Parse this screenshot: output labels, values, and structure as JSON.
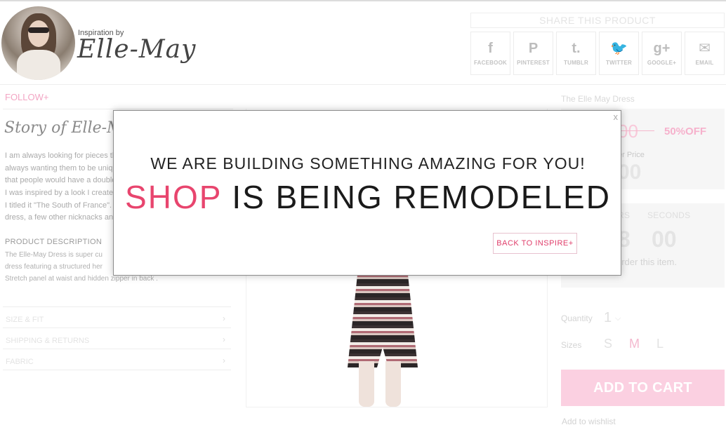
{
  "header": {
    "inspiration_label": "Inspiration by",
    "name_script": "Elle-May"
  },
  "share": {
    "title": "SHARE THIS PRODUCT",
    "buttons": [
      {
        "glyph": "f",
        "label": "FACEBOOK",
        "icon": "facebook-icon"
      },
      {
        "glyph": "P",
        "label": "PINTEREST",
        "icon": "pinterest-icon"
      },
      {
        "glyph": "t.",
        "label": "TUMBLR",
        "icon": "tumblr-icon"
      },
      {
        "glyph": "🐦",
        "label": "TWITTER",
        "icon": "twitter-icon"
      },
      {
        "glyph": "g+",
        "label": "GOOGLE+",
        "icon": "google-plus-icon"
      },
      {
        "glyph": "✉",
        "label": "EMAIL",
        "icon": "email-icon"
      }
    ]
  },
  "left": {
    "follow": "FOLLOW+",
    "story_title": "Story of Elle-Ma",
    "story_lines": [
      "I am always looking for pieces th",
      "always wanting them to be uniq",
      "that people would have a double",
      "I was inspired by a look I create",
      "I titled it \"The South of France\".",
      "dress, a few other nicknacks an"
    ],
    "description_title": "PRODUCT  DESCRIPTION",
    "description_lines": [
      "The Elle-May Dress is super cu",
      "dress featuring a structured her",
      "Stretch panel at waist and hidden zipper in back ."
    ],
    "accordion": [
      "SIZE & FIT",
      "SHIPPING & RETURNS",
      "FABRIC"
    ]
  },
  "right": {
    "product_name": "The Elle May Dress",
    "old_price": "00",
    "discount": "50%OFF",
    "member_label": "er Price",
    "member_price": "00",
    "timer_labels": [
      "RS",
      "SECONDS"
    ],
    "timer_values": [
      "8",
      "00"
    ],
    "order_text": "order this item.",
    "quantity_label": "Quantity",
    "quantity_value": "1",
    "sizes_label": "Sizes",
    "sizes": [
      "S",
      "M",
      "L"
    ],
    "selected_size": "M",
    "add_to_cart": "ADD TO CART",
    "wishlist": "Add to wishlist"
  },
  "modal": {
    "close": "x",
    "headline": "WE ARE BUILDING SOMETHING AMAZING FOR YOU!",
    "big_accent": "SHOP",
    "big_rest": " IS BEING REMODELED",
    "back_button": "BACK TO INSPIRE+"
  },
  "colors": {
    "accent_pink": "#e8456e",
    "cart_pink": "#fbd0e1"
  }
}
